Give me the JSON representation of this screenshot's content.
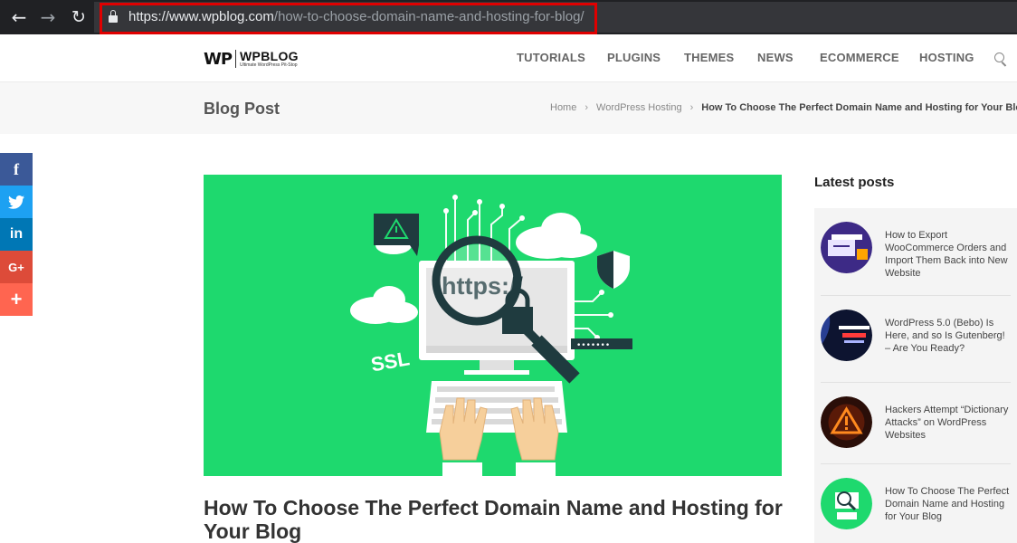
{
  "browser": {
    "url_host": "https://www.wpblog.com",
    "url_path": "/how-to-choose-domain-name-and-hosting-for-blog/",
    "icons": [
      "back-arrow-icon",
      "forward-arrow-icon",
      "reload-icon",
      "lock-icon"
    ]
  },
  "header": {
    "logo_mark": "WP",
    "logo_name": "WPBLOG",
    "logo_tagline": "Ultimate WordPress Pit-Stop",
    "nav": [
      "TUTORIALS",
      "PLUGINS",
      "THEMES",
      "NEWS",
      "ECOMMERCE",
      "HOSTING"
    ]
  },
  "title_bar": {
    "page_title": "Blog Post",
    "breadcrumb": [
      "Home",
      "WordPress Hosting",
      "How To Choose The Perfect Domain Name and Hosting for Your Blog"
    ]
  },
  "share": {
    "facebook": "f",
    "linkedin": "in",
    "google_plus": "G+",
    "more": "+"
  },
  "hero": {
    "ssl_text": "SSL",
    "https_text": "https://",
    "password_mask": "•••••••"
  },
  "article": {
    "title": "How To Choose The Perfect Domain Name and Hosting for Your Blog"
  },
  "sidebar": {
    "title": "Latest posts",
    "posts": [
      {
        "title": "How to Export WooCommerce Orders and Import Them Back into New Website"
      },
      {
        "title": "WordPress 5.0 (Bebo) Is Here, and so Is Gutenberg! – Are You Ready?"
      },
      {
        "title": "Hackers Attempt “Dictionary Attacks” on WordPress Websites"
      },
      {
        "title": "How To Choose The Perfect Domain Name and Hosting for Your Blog"
      }
    ]
  },
  "colors": {
    "brand_green": "#1ed96e",
    "highlight_red": "#e00000",
    "facebook": "#3b5998",
    "twitter": "#1da1f2",
    "linkedin": "#0077b5",
    "google_plus": "#dd4b39",
    "share_more": "#ff6550"
  }
}
